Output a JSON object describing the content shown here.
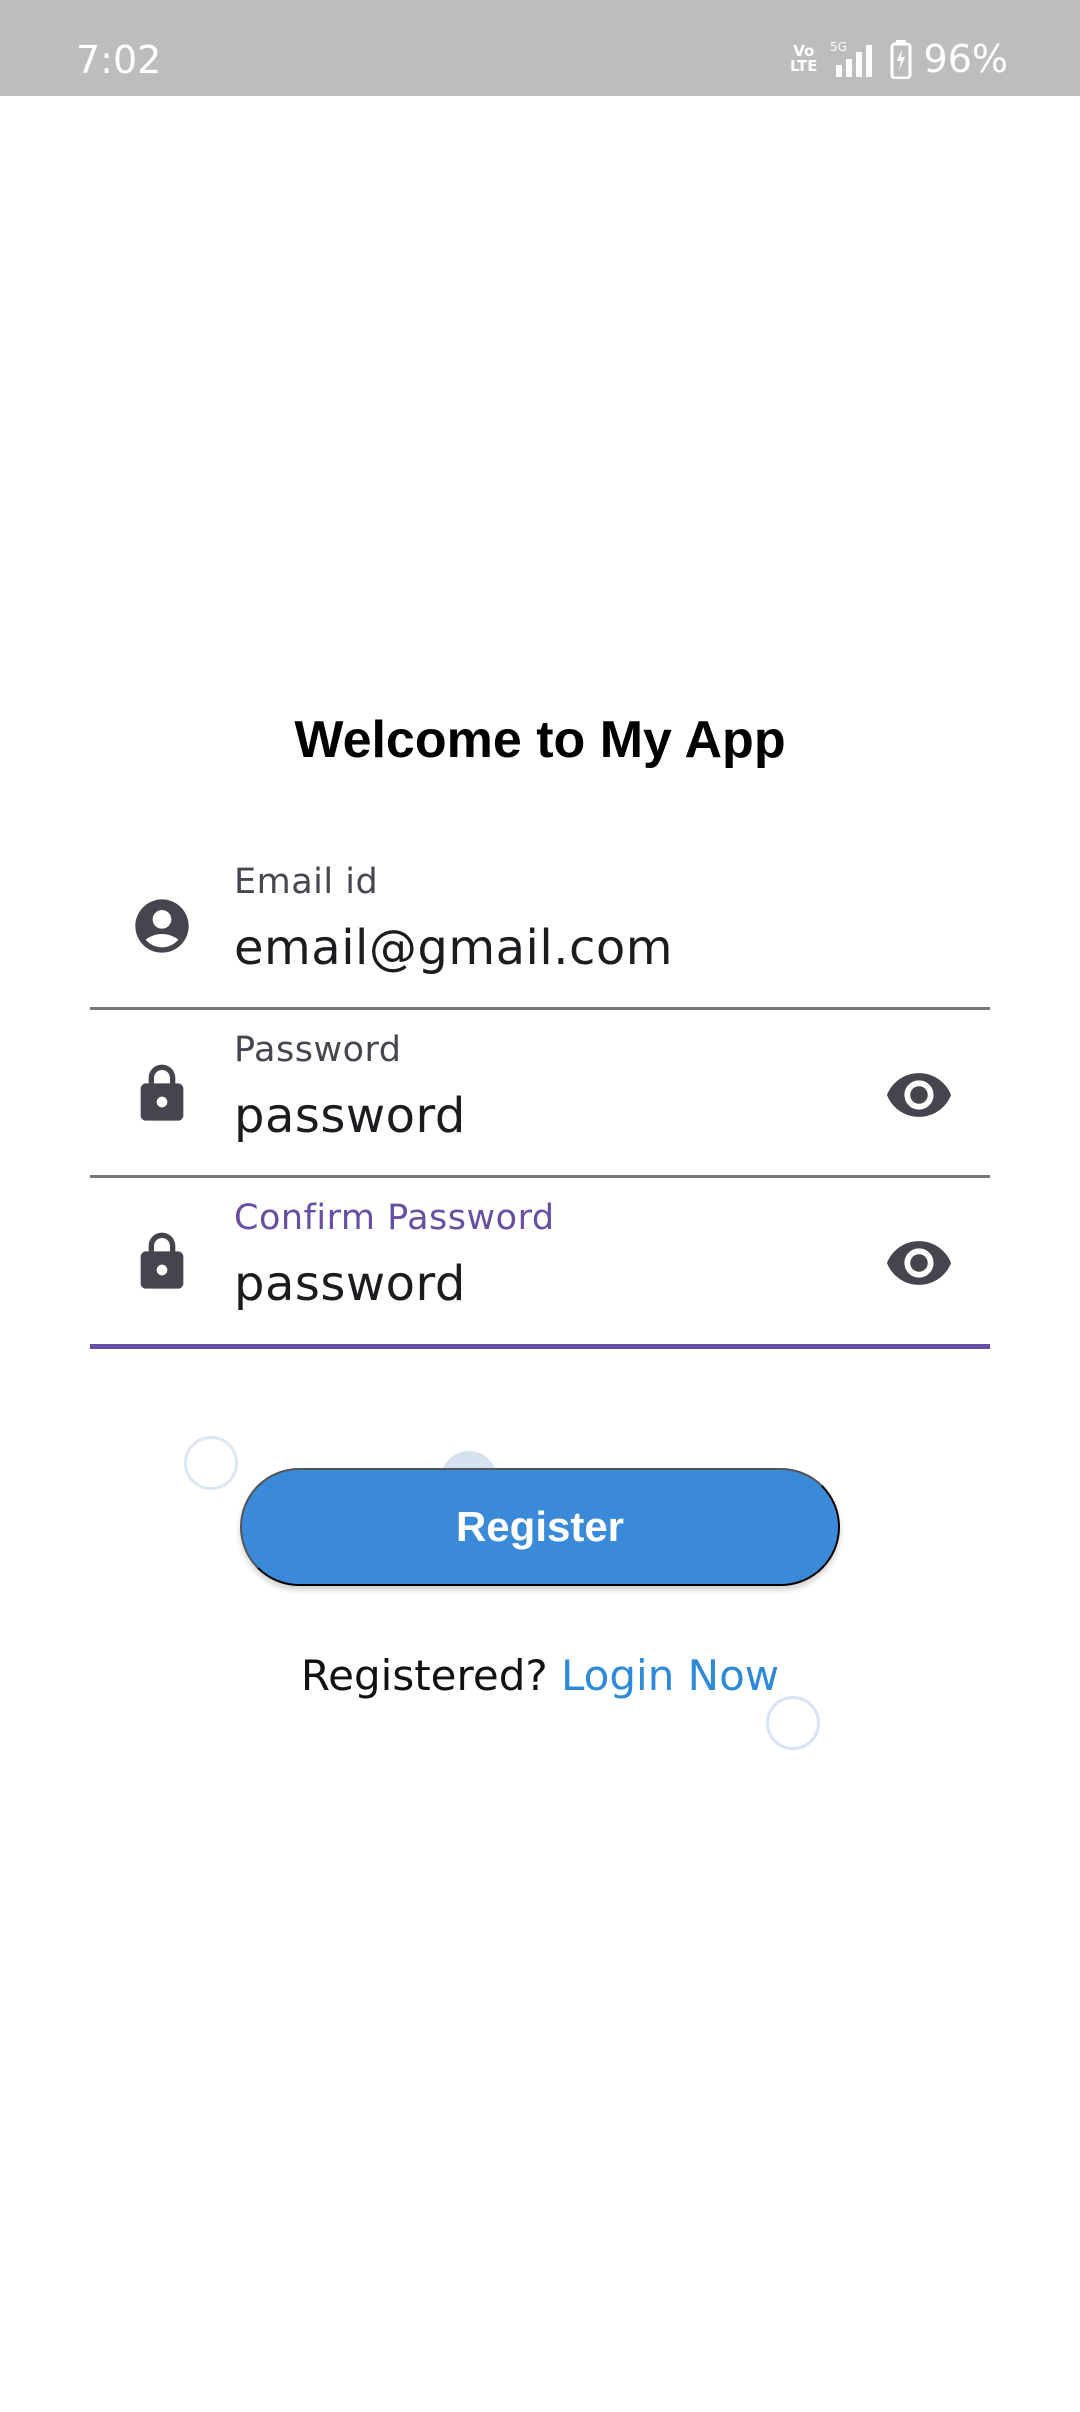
{
  "status_bar": {
    "time": "7:02",
    "volte_line1": "Vo",
    "volte_line2": "LTE",
    "network": "5G",
    "battery": "96%"
  },
  "title": "Welcome to My App",
  "form": {
    "email": {
      "label": "Email id",
      "value": "email@gmail.com",
      "icon": "account-circle-icon"
    },
    "password": {
      "label": "Password",
      "value": "password",
      "icon": "lock-icon"
    },
    "confirm_password": {
      "label": "Confirm Password",
      "value": "password",
      "icon": "lock-icon"
    }
  },
  "register_button": "Register",
  "footer": {
    "prompt": "Registered?",
    "link": "Login Now"
  },
  "colors": {
    "accent": "#6750a4",
    "button": "#3b8ad9",
    "link": "#2e8ad8",
    "status_bar": "#bdbdbd"
  }
}
